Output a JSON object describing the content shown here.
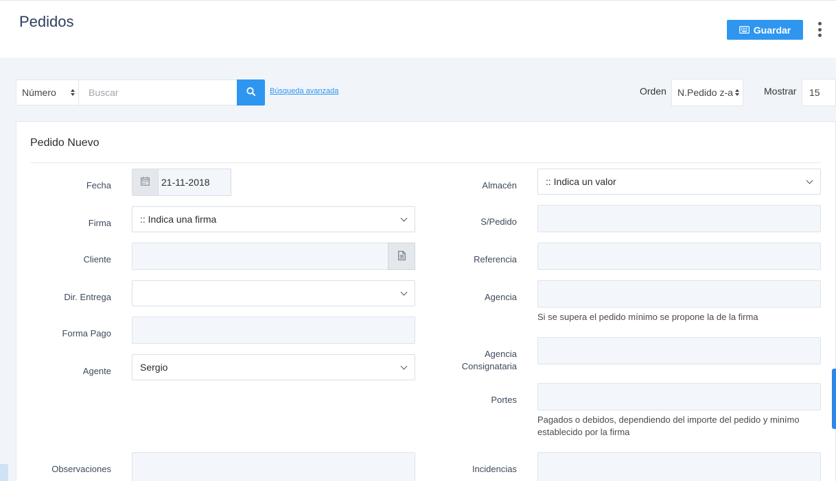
{
  "header": {
    "title": "Pedidos",
    "save_label": "Guardar"
  },
  "toolbar": {
    "field_select": "Número",
    "search_placeholder": "Buscar",
    "advanced_search": "Búsqueda avanzada",
    "order_label": "Orden",
    "order_value": "N.Pedido z-a",
    "show_label": "Mostrar",
    "show_value": "15"
  },
  "form": {
    "title": "Pedido Nuevo",
    "fecha": {
      "label": "Fecha",
      "value": "21-11-2018"
    },
    "firma": {
      "label": "Firma",
      "value": ":: Indica una firma"
    },
    "cliente": {
      "label": "Cliente",
      "value": ""
    },
    "dir_entrega": {
      "label": "Dir. Entrega",
      "value": ""
    },
    "forma_pago": {
      "label": "Forma Pago",
      "value": ""
    },
    "agente": {
      "label": "Agente",
      "value": "Sergio"
    },
    "observaciones": {
      "label": "Observaciones"
    },
    "almacen": {
      "label": "Almacén",
      "value": ":: Indica un valor"
    },
    "s_pedido": {
      "label": "S/Pedido"
    },
    "referencia": {
      "label": "Referencia"
    },
    "agencia": {
      "label": "Agencia",
      "help": "Si se supera el pedido mínimo se propone la de la firma"
    },
    "agencia_consignataria": {
      "label_line1": "Agencia",
      "label_line2": "Consignataria"
    },
    "portes": {
      "label": "Portes",
      "help_line1": "Pagados o debidos, dependiendo del importe del pedido y minímo",
      "help_line2": "establecido por la firma"
    },
    "incidencias": {
      "label": "Incidencias"
    }
  },
  "colors": {
    "accent": "#2f96f0",
    "title": "#2c3e5d",
    "input_bg": "#f3f6fa"
  },
  "icons": [
    "keyboard-icon",
    "more-vertical-icon",
    "search-icon",
    "calendar-icon",
    "document-icon",
    "chevron-down-icon"
  ]
}
